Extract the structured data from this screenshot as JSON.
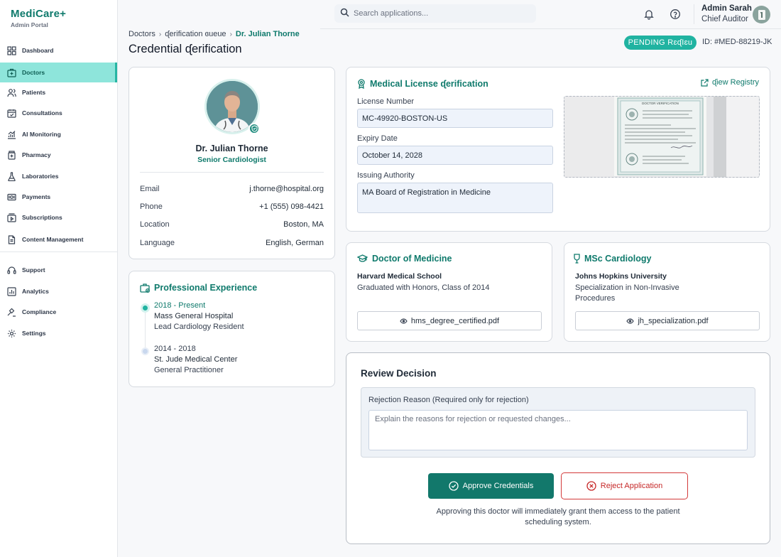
{
  "brand": {
    "name": "MediCare+",
    "subtitle": "Admin Portal"
  },
  "sidebar": {
    "items": [
      {
        "label": "Dashboard",
        "icon": "dashboard-icon"
      },
      {
        "label": "Doctors",
        "icon": "doctors-icon",
        "active": true
      },
      {
        "label": "Patients",
        "icon": "patients-icon"
      },
      {
        "label": "Consultations",
        "icon": "calendar-icon"
      },
      {
        "label": "AI Monitoring",
        "icon": "chart-icon"
      },
      {
        "label": "Pharmacy",
        "icon": "pharmacy-icon"
      },
      {
        "label": "Laboratories",
        "icon": "flask-icon"
      },
      {
        "label": "Payments",
        "icon": "payments-icon"
      },
      {
        "label": "Subscriptions",
        "icon": "subscriptions-icon"
      },
      {
        "label": "Content Management",
        "icon": "document-icon"
      }
    ],
    "secondary": [
      {
        "label": "Support",
        "icon": "support-icon"
      },
      {
        "label": "Analytics",
        "icon": "analytics-icon"
      },
      {
        "label": "Compliance",
        "icon": "gavel-icon"
      },
      {
        "label": "Settings",
        "icon": "gear-icon"
      }
    ]
  },
  "search": {
    "placeholder": "Search applications..."
  },
  "user": {
    "name": "Admin Sarah",
    "role": "Chief Auditor"
  },
  "breadcrumb": {
    "items": [
      "Doctors",
      "ᶑerification ɞueue"
    ],
    "current": "Dr. Julian Thorne"
  },
  "page": {
    "title": "Credential ᶑerification",
    "status": "PENDING RɛᶑIɛu",
    "record_id": "ID: #MED-88219-JK"
  },
  "profile": {
    "name": "Dr. Julian Thorne",
    "specialty": "Senior Cardiologist",
    "info": [
      {
        "label": "Email",
        "value": "j.thorne@hospital.org"
      },
      {
        "label": "Phone",
        "value": "+1 (555) 098-4421"
      },
      {
        "label": "Location",
        "value": "Boston, MA"
      },
      {
        "label": "Language",
        "value": "English, German"
      }
    ]
  },
  "experience": {
    "title": "Professional Experience",
    "items": [
      {
        "dates": "2018 - Present",
        "organization": "Mass General Hospital",
        "role": "Lead Cardiology Resident"
      },
      {
        "dates": "2014 - 2018",
        "organization": "St. Jude Medical Center",
        "role": "General Practitioner"
      }
    ]
  },
  "license": {
    "title": "Medical License ᶑerification",
    "view_registry": "ᶑiew Registry",
    "fields": [
      {
        "label": "License Number",
        "value": "MC-49920-BOSTON-US"
      },
      {
        "label": "Expiry Date",
        "value": "October 14, 2028"
      },
      {
        "label": "Issuing Authority",
        "value": "MA Board of Registration in Medicine"
      }
    ]
  },
  "degrees": [
    {
      "title": "Doctor of Medicine",
      "icon": "graduation-cap-icon",
      "school": "Harvard Medical School",
      "description": "Graduated with Honors, Class of 2014",
      "file": "hms_degree_certified.pdf"
    },
    {
      "title": "MSc Cardiology",
      "icon": "award-icon",
      "school": "Johns Hopkins University",
      "description": "Specialization in Non-Invasive Procedures",
      "file": "jh_specialization.pdf"
    }
  ],
  "review": {
    "title": "Review Decision",
    "reason_label": "Rejection Reason (Required only for rejection)",
    "reason_placeholder": "Explain the reasons for rejection or requested changes...",
    "approve_label": "Approve Credentials",
    "reject_label": "Reject Application",
    "note": "Approving this doctor will immediately grant them access to the patient scheduling system."
  },
  "colors": {
    "primary": "#0f7a6c",
    "accent": "#20b3a1",
    "active_nav": "#8ee5db",
    "reject": "#d33a3a"
  }
}
